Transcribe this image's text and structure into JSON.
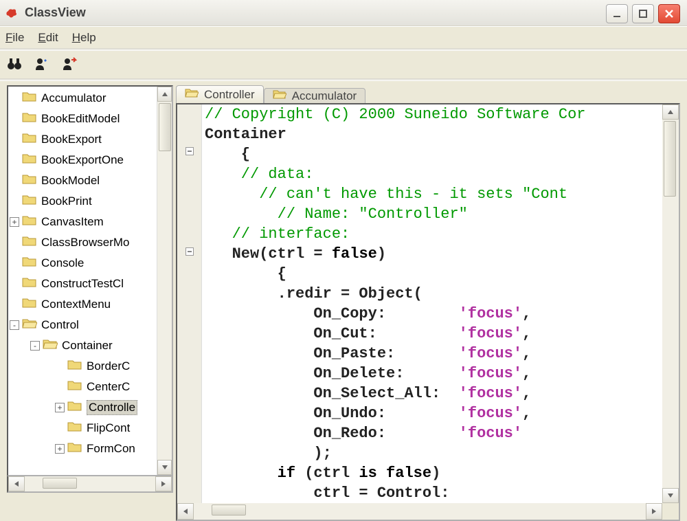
{
  "window": {
    "title": "ClassView"
  },
  "menu": {
    "file": "File",
    "edit": "Edit",
    "help": "Help"
  },
  "tree": {
    "items": [
      {
        "label": "Accumulator",
        "level": 0,
        "toggle": ""
      },
      {
        "label": "BookEditModel",
        "level": 0,
        "toggle": ""
      },
      {
        "label": "BookExport",
        "level": 0,
        "toggle": ""
      },
      {
        "label": "BookExportOne",
        "level": 0,
        "toggle": ""
      },
      {
        "label": "BookModel",
        "level": 0,
        "toggle": ""
      },
      {
        "label": "BookPrint",
        "level": 0,
        "toggle": ""
      },
      {
        "label": "CanvasItem",
        "level": 0,
        "toggle": "+"
      },
      {
        "label": "ClassBrowserMo",
        "level": 0,
        "toggle": ""
      },
      {
        "label": "Console",
        "level": 0,
        "toggle": ""
      },
      {
        "label": "ConstructTestCl",
        "level": 0,
        "toggle": ""
      },
      {
        "label": "ContextMenu",
        "level": 0,
        "toggle": ""
      },
      {
        "label": "Control",
        "level": 0,
        "toggle": "-",
        "open": true
      },
      {
        "label": "Container",
        "level": 1,
        "toggle": "-",
        "open": true
      },
      {
        "label": "BorderC",
        "level": 2,
        "toggle": ""
      },
      {
        "label": "CenterC",
        "level": 2,
        "toggle": ""
      },
      {
        "label": "Controlle",
        "level": 2,
        "toggle": "+",
        "selected": true
      },
      {
        "label": "FlipCont",
        "level": 2,
        "toggle": ""
      },
      {
        "label": "FormCon",
        "level": 2,
        "toggle": "+"
      }
    ]
  },
  "tabs": [
    {
      "label": "Controller",
      "active": true
    },
    {
      "label": "Accumulator",
      "active": false
    }
  ],
  "code": {
    "l1": "// Copyright (C) 2000 Suneido Software Cor",
    "l2": "Container",
    "l3": "    {",
    "l4": "    // data:",
    "l5": "      // can't have this - it sets \"Cont",
    "l6": "        // Name: \"Controller\"",
    "l7": "   // interface:",
    "l8a": "   New(ctrl = ",
    "l8b": "false",
    "l8c": ")",
    "l9": "        {",
    "l10": "        .redir = Object(",
    "l11a": "            On_Copy:        ",
    "l11b": "'focus'",
    "l11c": ",",
    "l12a": "            On_Cut:         ",
    "l12b": "'focus'",
    "l12c": ",",
    "l13a": "            On_Paste:       ",
    "l13b": "'focus'",
    "l13c": ",",
    "l14a": "            On_Delete:      ",
    "l14b": "'focus'",
    "l14c": ",",
    "l15a": "            On_Select_All:  ",
    "l15b": "'focus'",
    "l15c": ",",
    "l16a": "            On_Undo:        ",
    "l16b": "'focus'",
    "l16c": ",",
    "l17a": "            On_Redo:        ",
    "l17b": "'focus'",
    "l18": "            );",
    "l19a": "        ",
    "l19b": "if",
    "l19c": " (ctrl ",
    "l19d": "is false",
    "l19e": ")",
    "l20": "            ctrl = Control:"
  }
}
